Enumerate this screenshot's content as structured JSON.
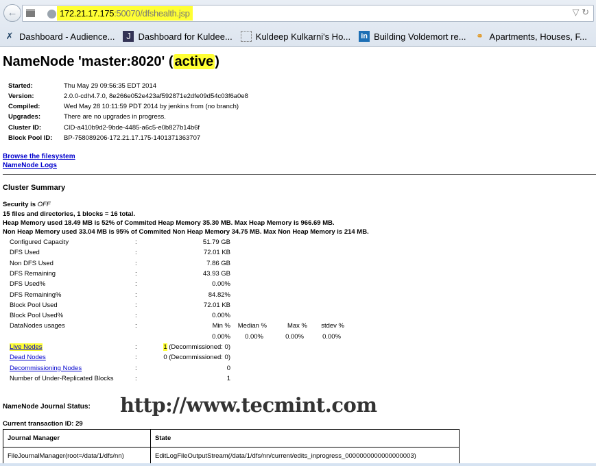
{
  "browser": {
    "url_host": "172.21.17.175",
    "url_path": ":50070/dfshealth.jsp",
    "bookmarks": [
      {
        "icon": "scissors-icon",
        "label": "Dashboard - Audience..."
      },
      {
        "icon": "jenkins-icon",
        "label": "Dashboard for Kuldee..."
      },
      {
        "icon": "blank-page-icon",
        "label": "Kuldeep Kulkarni's Ho..."
      },
      {
        "icon": "linkedin-icon",
        "label": "Building Voldemort re..."
      },
      {
        "icon": "key-icon",
        "label": "Apartments, Houses, F..."
      }
    ]
  },
  "page": {
    "title_prefix": "NameNode 'master:8020' (",
    "title_state": "active",
    "title_suffix": ")",
    "info": [
      {
        "k": "Started:",
        "v": "Thu May 29 09:56:35 EDT 2014"
      },
      {
        "k": "Version:",
        "v": "2.0.0-cdh4.7.0, 8e266e052e423af592871e2dfe09d54c03f6a0e8"
      },
      {
        "k": "Compiled:",
        "v": "Wed May 28 10:11:59 PDT 2014 by jenkins from (no branch)"
      },
      {
        "k": "Upgrades:",
        "v": "There are no upgrades in progress."
      },
      {
        "k": "Cluster ID:",
        "v": "CID-a410b9d2-9bde-4485-a6c5-e0b827b14b6f"
      },
      {
        "k": "Block Pool ID:",
        "v": "BP-758089206-172.21.17.175-1401371363707"
      }
    ],
    "links": {
      "browse": "Browse the filesystem",
      "logs": "NameNode Logs"
    },
    "cluster_summary": "Cluster Summary",
    "security_prefix": "Security is ",
    "security_state": "OFF",
    "files_line": "15 files and directories, 1 blocks = 16 total.",
    "heap_line": "Heap Memory used 18.49 MB is 52% of Commited Heap Memory 35.30 MB. Max Heap Memory is 966.69 MB.",
    "nonheap_line": "Non Heap Memory used 33.04 MB is 95% of Commited Non Heap Memory 34.75 MB. Max Non Heap Memory is 214 MB.",
    "colon": ":",
    "stats": [
      {
        "k": "Configured Capacity",
        "v": "51.79 GB"
      },
      {
        "k": "DFS Used",
        "v": "72.01 KB"
      },
      {
        "k": "Non DFS Used",
        "v": "7.86 GB"
      },
      {
        "k": "DFS Remaining",
        "v": "43.93 GB"
      },
      {
        "k": "DFS Used%",
        "v": "0.00%"
      },
      {
        "k": "DFS Remaining%",
        "v": "84.82%"
      },
      {
        "k": "Block Pool Used",
        "v": "72.01 KB"
      },
      {
        "k": "Block Pool Used%",
        "v": "0.00%"
      }
    ],
    "usages": {
      "k": "DataNodes usages",
      "headers": [
        "Min %",
        "Median %",
        "Max %",
        "stdev %"
      ],
      "values": [
        "0.00%",
        "0.00%",
        "0.00%",
        "0.00%"
      ]
    },
    "nodes": [
      {
        "k": "Live Nodes",
        "n": "1",
        "v": " (Decommissioned: 0)"
      },
      {
        "k": "Dead Nodes",
        "n": "0",
        "v": " (Decommissioned: 0)"
      },
      {
        "k": "Decommissioning Nodes",
        "n": "",
        "v": "0"
      }
    ],
    "under_replicated": {
      "k": "Number of Under-Replicated Blocks",
      "v": "1"
    },
    "journal_title": "NameNode Journal Status:",
    "transaction": "Current transaction ID: 29",
    "journal_table": {
      "headers": [
        "Journal Manager",
        "State"
      ],
      "rows": [
        [
          "FileJournalManager(root=/data/1/dfs/nn)",
          "EditLogFileOutputStream(/data/1/dfs/nn/current/edits_inprogress_0000000000000000003)"
        ]
      ]
    },
    "watermark": "http://www.tecmint.com"
  }
}
